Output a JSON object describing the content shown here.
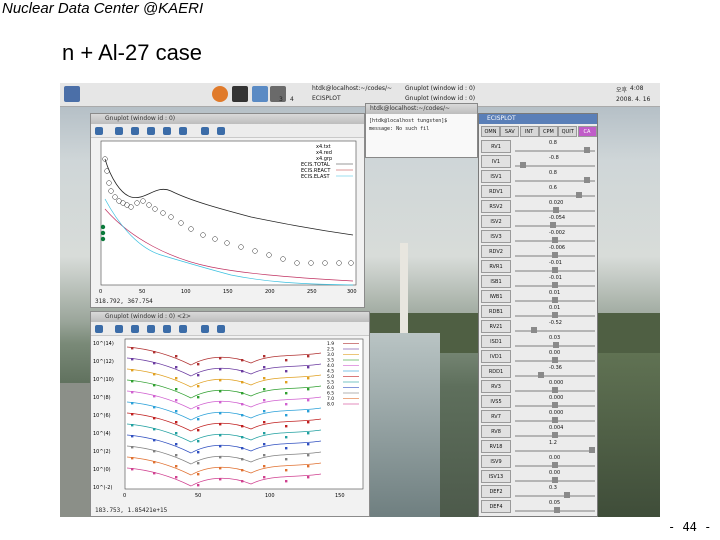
{
  "header": {
    "text": "Nuclear Data Center @KAERI"
  },
  "slide": {
    "title": "n + Al-27 case",
    "page": "- 44 -"
  },
  "taskbar": {
    "workspace_1": "3",
    "workspace_2": "4",
    "item_1": "htdk@localhost:~/codes/~",
    "item_2": "ECISPLOT",
    "item_3": "Gnuplot (window id : 0)",
    "item_4": "Gnuplot (window id : 0)",
    "clock_time": "4:08",
    "clock_prefix": "오후",
    "clock_date": "2008. 4. 16"
  },
  "plot1": {
    "title": "Gnuplot (window id : 0)",
    "status": "318.792, 367.754",
    "legend": [
      "x4.txt",
      "x4.red",
      "x4.grp",
      "ECIS.TOTAL",
      "ECIS.REACT",
      "ECIS.ELAST"
    ],
    "x_ticks": [
      "0",
      "50",
      "100",
      "150",
      "200",
      "250",
      "300"
    ]
  },
  "plot2": {
    "title": "Gnuplot (window id : 0) <2>",
    "status": "183.753, 1.85421e+15",
    "y_ticks": [
      "10^(14)",
      "10^(12)",
      "10^(10)",
      "10^(8)",
      "10^(6)",
      "10^(4)",
      "10^(2)",
      "10^(0)",
      "10^(-2)"
    ],
    "x_ticks": [
      "0",
      "50",
      "100",
      "150"
    ],
    "legend": [
      "1.9",
      "2.5",
      "3.0",
      "3.5",
      "4.0",
      "4.5",
      "5.0",
      "5.5",
      "6.0",
      "6.5",
      "7.0",
      "8.0"
    ]
  },
  "terminal": {
    "title": "htdk@localhost:~/codes/~",
    "line1": "[htdk@localhost tungsten]$",
    "line2": "message: No such fil"
  },
  "ecisplot": {
    "title": "ECISPLOT",
    "tabs": [
      "OMN",
      "SAV",
      "INT",
      "CPM",
      "QUIT",
      "CA"
    ],
    "params": [
      {
        "name": "RV1",
        "value": "0.8"
      },
      {
        "name": "IV1",
        "value": "-0.8"
      },
      {
        "name": "ISV1",
        "value": "0.8"
      },
      {
        "name": "RDV1",
        "value": "0.6"
      },
      {
        "name": "RSV2",
        "value": "0.020"
      },
      {
        "name": "ISV2",
        "value": "-0.054"
      },
      {
        "name": "ISV3",
        "value": "-0.002"
      },
      {
        "name": "RDV2",
        "value": "-0.006"
      },
      {
        "name": "RVR1",
        "value": "-0.01"
      },
      {
        "name": "ISB1",
        "value": "-0.01"
      },
      {
        "name": "IWB1",
        "value": "0.01"
      },
      {
        "name": "RDB1",
        "value": "0.01"
      },
      {
        "name": "RV21",
        "value": "-0.52"
      },
      {
        "name": "ISD1",
        "value": "0.03"
      },
      {
        "name": "IVD1",
        "value": "0.00"
      },
      {
        "name": "RDD1",
        "value": "-0.36"
      },
      {
        "name": "RV3",
        "value": "0.000"
      },
      {
        "name": "IVS5",
        "value": "0.000"
      },
      {
        "name": "RV7",
        "value": "0.000"
      },
      {
        "name": "RV8",
        "value": "0.004"
      },
      {
        "name": "RV18",
        "value": "1.2"
      },
      {
        "name": "ISV9",
        "value": "0.00"
      },
      {
        "name": "ISV13",
        "value": "0.00"
      },
      {
        "name": "DEF2",
        "value": "0.3"
      },
      {
        "name": "DEF4",
        "value": "0.05"
      }
    ]
  },
  "colors": {
    "accent": "#5a7fb8",
    "active_tab": "#c05cc8"
  }
}
